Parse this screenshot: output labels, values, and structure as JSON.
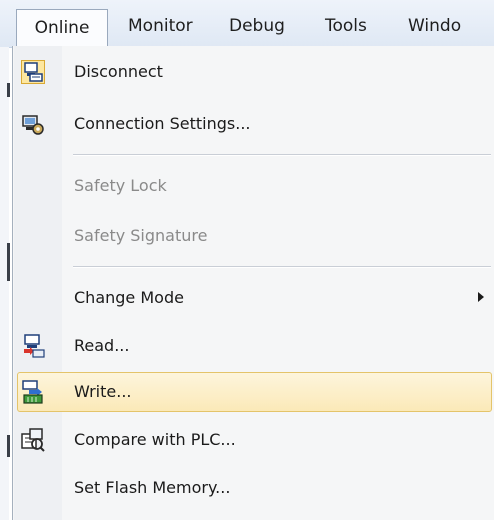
{
  "menubar": {
    "items": [
      "Online",
      "Monitor",
      "Debug",
      "Tools",
      "Windo"
    ]
  },
  "menu": {
    "disconnect": {
      "label": "Disconnect",
      "icon": "disconnect-icon"
    },
    "connection_settings": {
      "label": "Connection Settings...",
      "icon": "connection-settings-icon"
    },
    "safety_lock": {
      "label": "Safety Lock",
      "enabled": false
    },
    "safety_signature": {
      "label": "Safety Signature",
      "enabled": false
    },
    "change_mode": {
      "label": "Change Mode",
      "has_submenu": true
    },
    "read": {
      "label": "Read...",
      "icon": "read-icon"
    },
    "write": {
      "label": "Write...",
      "icon": "write-icon",
      "highlighted": true
    },
    "compare": {
      "label": "Compare with PLC...",
      "icon": "compare-icon"
    },
    "flash": {
      "label": "Set Flash Memory..."
    }
  },
  "colors": {
    "hover_bg": "#fbe9b8",
    "hover_border": "#e4c46a",
    "disabled_text": "#8a8a8a"
  }
}
